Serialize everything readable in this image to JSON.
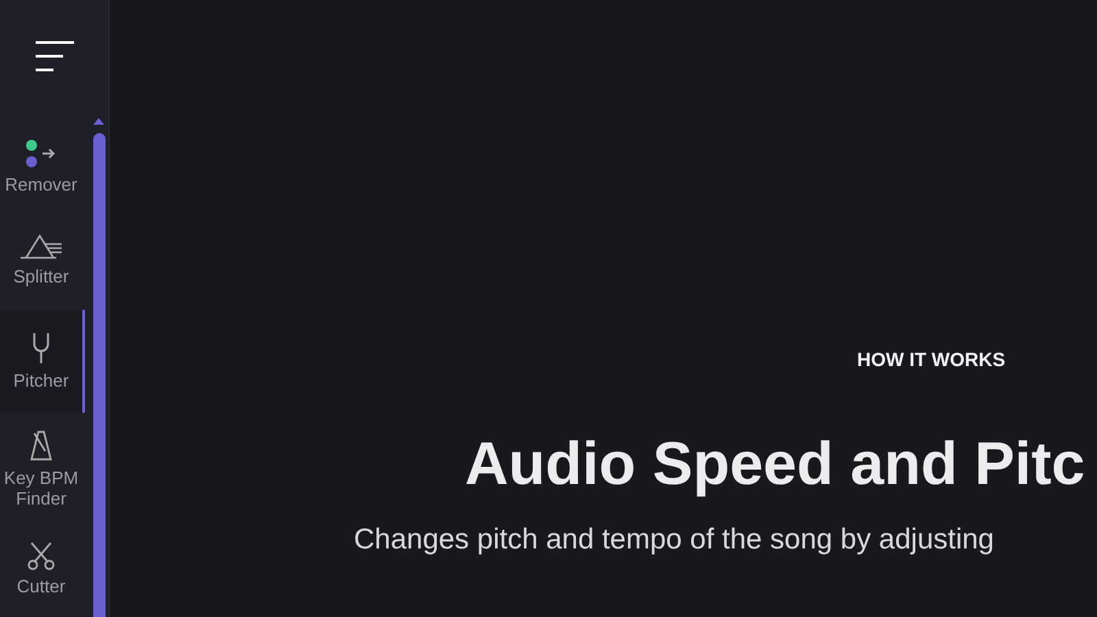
{
  "sidebar": {
    "items": [
      {
        "kind": "remover",
        "label": "Remover",
        "selected": false
      },
      {
        "kind": "splitter",
        "label": "Splitter",
        "selected": false
      },
      {
        "kind": "pitcher",
        "label": "Pitcher",
        "selected": true
      },
      {
        "kind": "metronome",
        "label": "Key BPM Finder",
        "selected": false
      },
      {
        "kind": "cutter",
        "label": "Cutter",
        "selected": false
      }
    ]
  },
  "main": {
    "eyebrow": "HOW IT WORKS",
    "title": "Audio Speed and Pitc",
    "subtitle": "Changes pitch and tempo of the song by adjusting"
  }
}
